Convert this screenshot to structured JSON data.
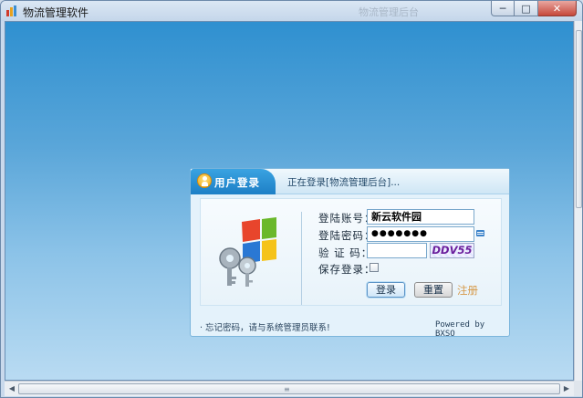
{
  "window": {
    "title": "物流管理软件",
    "title_faded": "物流管理后台",
    "buttons": {
      "minimize": "─",
      "maximize": "□",
      "close": "✕"
    },
    "icon": "app-logo-icon"
  },
  "panel": {
    "title": "用户登录",
    "status": "正在登录[物流管理后台]...",
    "user_icon": "user-icon",
    "logo_icon": "windows-keys-logo"
  },
  "form": {
    "account_label": "登陆账号：",
    "account_value": "新云软件园",
    "password_label": "登陆密码：",
    "password_value": "●●●●●●●",
    "captcha_label": "验 证 码：",
    "captcha_value": "",
    "captcha_image_text": "DDV55",
    "remember_label": "保存登录：",
    "remember_checked": false,
    "keyboard_icon": "soft-keyboard-icon"
  },
  "buttons": {
    "login": "登录",
    "reset": "重置",
    "register": "注册"
  },
  "footer": {
    "left": "· 忘记密码，请与系统管理员联系!",
    "right": "Powered by BXSO"
  },
  "scrollbars": {
    "horizontal_arrows": [
      "◀",
      "▶"
    ],
    "grip": "≡"
  },
  "colors": {
    "accent": "#1d7fc6",
    "background_top": "#2f90d0",
    "register_link": "#d69a4a",
    "captcha_text": "#6b1e9c"
  }
}
